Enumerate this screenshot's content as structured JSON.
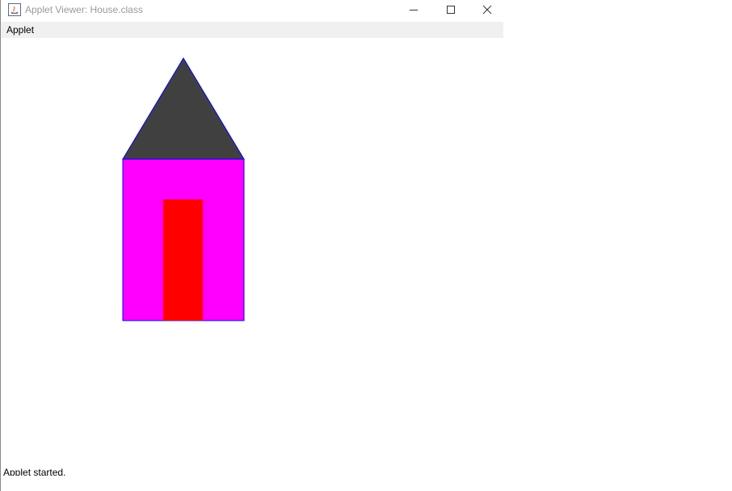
{
  "window": {
    "title": "Applet Viewer: House.class",
    "controls": {
      "minimize_icon": "minimize-icon",
      "maximize_icon": "maximize-icon",
      "close_icon": "close-icon"
    }
  },
  "menubar": {
    "items": [
      {
        "label": "Applet"
      }
    ]
  },
  "applet": {
    "drawing": {
      "roof": {
        "color": "#404040",
        "outline": "#0000ff"
      },
      "body": {
        "color": "#ff00ff",
        "outline": "#0000ff"
      },
      "door": {
        "color": "#ff0000"
      }
    }
  },
  "status": {
    "text": "Applet started."
  }
}
